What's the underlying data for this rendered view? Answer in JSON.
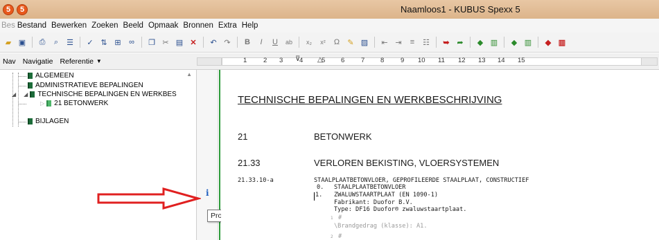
{
  "window": {
    "logo_letter": "5",
    "title": "Naamloos1 - KUBUS Spexx 5"
  },
  "menu": {
    "items": [
      "Bes",
      "Bestand",
      "Bewerken",
      "Zoeken",
      "Beeld",
      "Opmaak",
      "Bronnen",
      "Extra",
      "Help"
    ]
  },
  "toolbar": {
    "icons": [
      "new-icon",
      "new-doc-icon",
      "open-icon",
      "save-icon",
      "print-icon",
      "print-preview-icon",
      "list-icon",
      "check-icon",
      "arrows-icon",
      "tree-icon",
      "binoculars-icon",
      "copy-icon",
      "cut-icon",
      "paste-icon",
      "delete-icon",
      "undo-icon",
      "redo-icon",
      "bold-icon",
      "italic-icon",
      "underline-icon",
      "strike-icon",
      "subscript-icon",
      "superscript-icon",
      "omega-icon",
      "pencil-icon",
      "image-icon",
      "indent-left-icon",
      "indent-right-icon",
      "numbered-list-icon",
      "bullet-list-icon",
      "red-arrow-icon",
      "green-arrow-icon",
      "book-green-icon",
      "book-open-icon",
      "book-green2-icon",
      "book-open2-icon",
      "book-red-icon",
      "book-red-open-icon"
    ],
    "labels": {
      "bold": "B",
      "italic": "I",
      "underline": "U",
      "strike": "ab",
      "omega": "Ω"
    }
  },
  "navbar": {
    "nav_label": "Nav",
    "navigatie_label": "Navigatie",
    "referentie_label": "Referentie"
  },
  "tree": {
    "items": [
      {
        "label": "ALGEMEEN"
      },
      {
        "label": "ADMINISTRATIEVE BEPALINGEN"
      },
      {
        "label": "TECHNISCHE BEPALINGEN EN WERKBES"
      },
      {
        "label": "21  BETONWERK"
      },
      {
        "label": "BIJLAGEN"
      }
    ]
  },
  "ruler": {
    "labels": [
      "1",
      "2",
      "3",
      "4",
      "5",
      "6",
      "7",
      "8",
      "9",
      "10",
      "11",
      "12",
      "13",
      "14",
      "15"
    ]
  },
  "margin": {
    "info_glyph": "i",
    "tooltip": "Product info"
  },
  "document": {
    "title": "TECHNISCHE BEPALINGEN EN WERKBESCHRIJVING",
    "chapter_num": "21",
    "chapter_title": "BETONWERK",
    "section_num": "21.33",
    "section_title": "VERLOREN BEKISTING, VLOERSYSTEMEN",
    "item_code": "21.33.10-a",
    "item_title": "STAALPLAATBETONVLOER, GEPROFILEERDE STAALPLAAT, CONSTRUCTIEF",
    "line0_num": "0.",
    "line0_text": "STAALPLAATBETONVLOER",
    "line1_num": "1.",
    "line1_text": "ZWALUWSTAARTPLAAT (EN 1090-1)",
    "line_fabrikant": "Fabrikant: Duofor B.V.",
    "line_type": "Type: DF16 Duofor® zwaluwstaartplaat.",
    "small1": "1",
    "hash1": "#",
    "brandgedrag": "\\Brandgedrag (klasse): A1.",
    "small2": "2",
    "hash2": "#"
  },
  "colors": {
    "titlebar": "#dcb48a",
    "logo": "#e8581c",
    "green_line": "#2c9a3a",
    "arrow": "#e02020",
    "info_icon": "#1f5fbf"
  }
}
